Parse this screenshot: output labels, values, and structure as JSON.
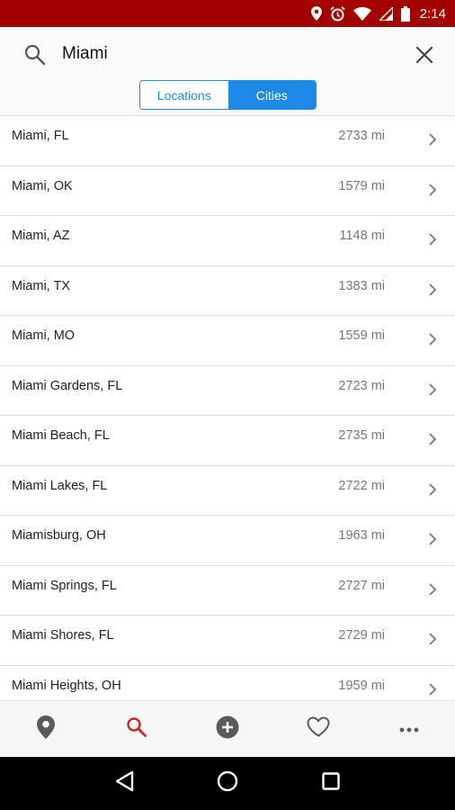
{
  "status_bar": {
    "time": "2:14",
    "background": "#a30000",
    "icons": [
      "location-icon",
      "alarm-icon",
      "wifi-icon",
      "signal-icon",
      "battery-icon"
    ]
  },
  "search": {
    "query": "Miami",
    "icon": "search-icon",
    "clear_icon": "close-icon"
  },
  "segments": [
    {
      "label": "Locations",
      "active": false
    },
    {
      "label": "Cities",
      "active": true
    }
  ],
  "accent_color": "#1e88e5",
  "results": [
    {
      "name": "Miami, FL",
      "distance": "2733 mi"
    },
    {
      "name": "Miami, OK",
      "distance": "1579 mi"
    },
    {
      "name": "Miami, AZ",
      "distance": "1148 mi"
    },
    {
      "name": "Miami, TX",
      "distance": "1383 mi"
    },
    {
      "name": "Miami, MO",
      "distance": "1559 mi"
    },
    {
      "name": "Miami Gardens, FL",
      "distance": "2723 mi"
    },
    {
      "name": "Miami Beach, FL",
      "distance": "2735 mi"
    },
    {
      "name": "Miami Lakes, FL",
      "distance": "2722 mi"
    },
    {
      "name": "Miamisburg, OH",
      "distance": "1963 mi"
    },
    {
      "name": "Miami Springs, FL",
      "distance": "2727 mi"
    },
    {
      "name": "Miami Shores, FL",
      "distance": "2729 mi"
    },
    {
      "name": "Miami Heights, OH",
      "distance": "1959 mi"
    }
  ],
  "bottom_nav": [
    {
      "icon": "map-pin-icon",
      "active": false
    },
    {
      "icon": "search-icon",
      "active": true
    },
    {
      "icon": "add-circle-icon",
      "active": false
    },
    {
      "icon": "heart-icon",
      "active": false
    },
    {
      "icon": "more-icon",
      "active": false
    }
  ],
  "bottom_nav_active_color": "#c62828",
  "system_nav": [
    "back-icon",
    "home-icon",
    "recents-icon"
  ]
}
